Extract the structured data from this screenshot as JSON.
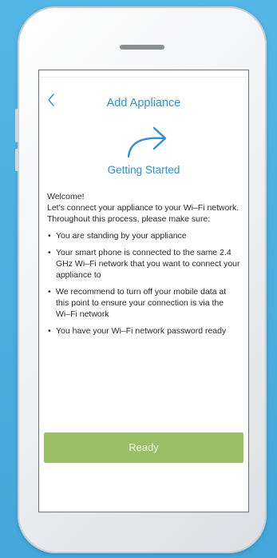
{
  "nav": {
    "title": "Add Appliance",
    "back_icon": "chevron-left-icon"
  },
  "hero": {
    "icon": "curved-arrow-right-icon",
    "subtitle": "Getting Started"
  },
  "intro": {
    "welcome": "Welcome!",
    "line1": "Let's connect your appliance to your Wi–Fi network.",
    "line2": "Throughout this process, please make sure:"
  },
  "bullets": [
    "You are standing by your appliance",
    "Your smart phone is connected to the same 2.4 GHz Wi–Fi network that you want to connect your appliance to",
    "We recommend to turn off your mobile data at this point to ensure your connection is via the Wi–Fi network",
    "You have your Wi–Fi network password ready"
  ],
  "footer": {
    "ready_label": "Ready"
  },
  "colors": {
    "background": "#4ab0e0",
    "accent": "#2f8fd8",
    "button": "#9bbf66"
  }
}
